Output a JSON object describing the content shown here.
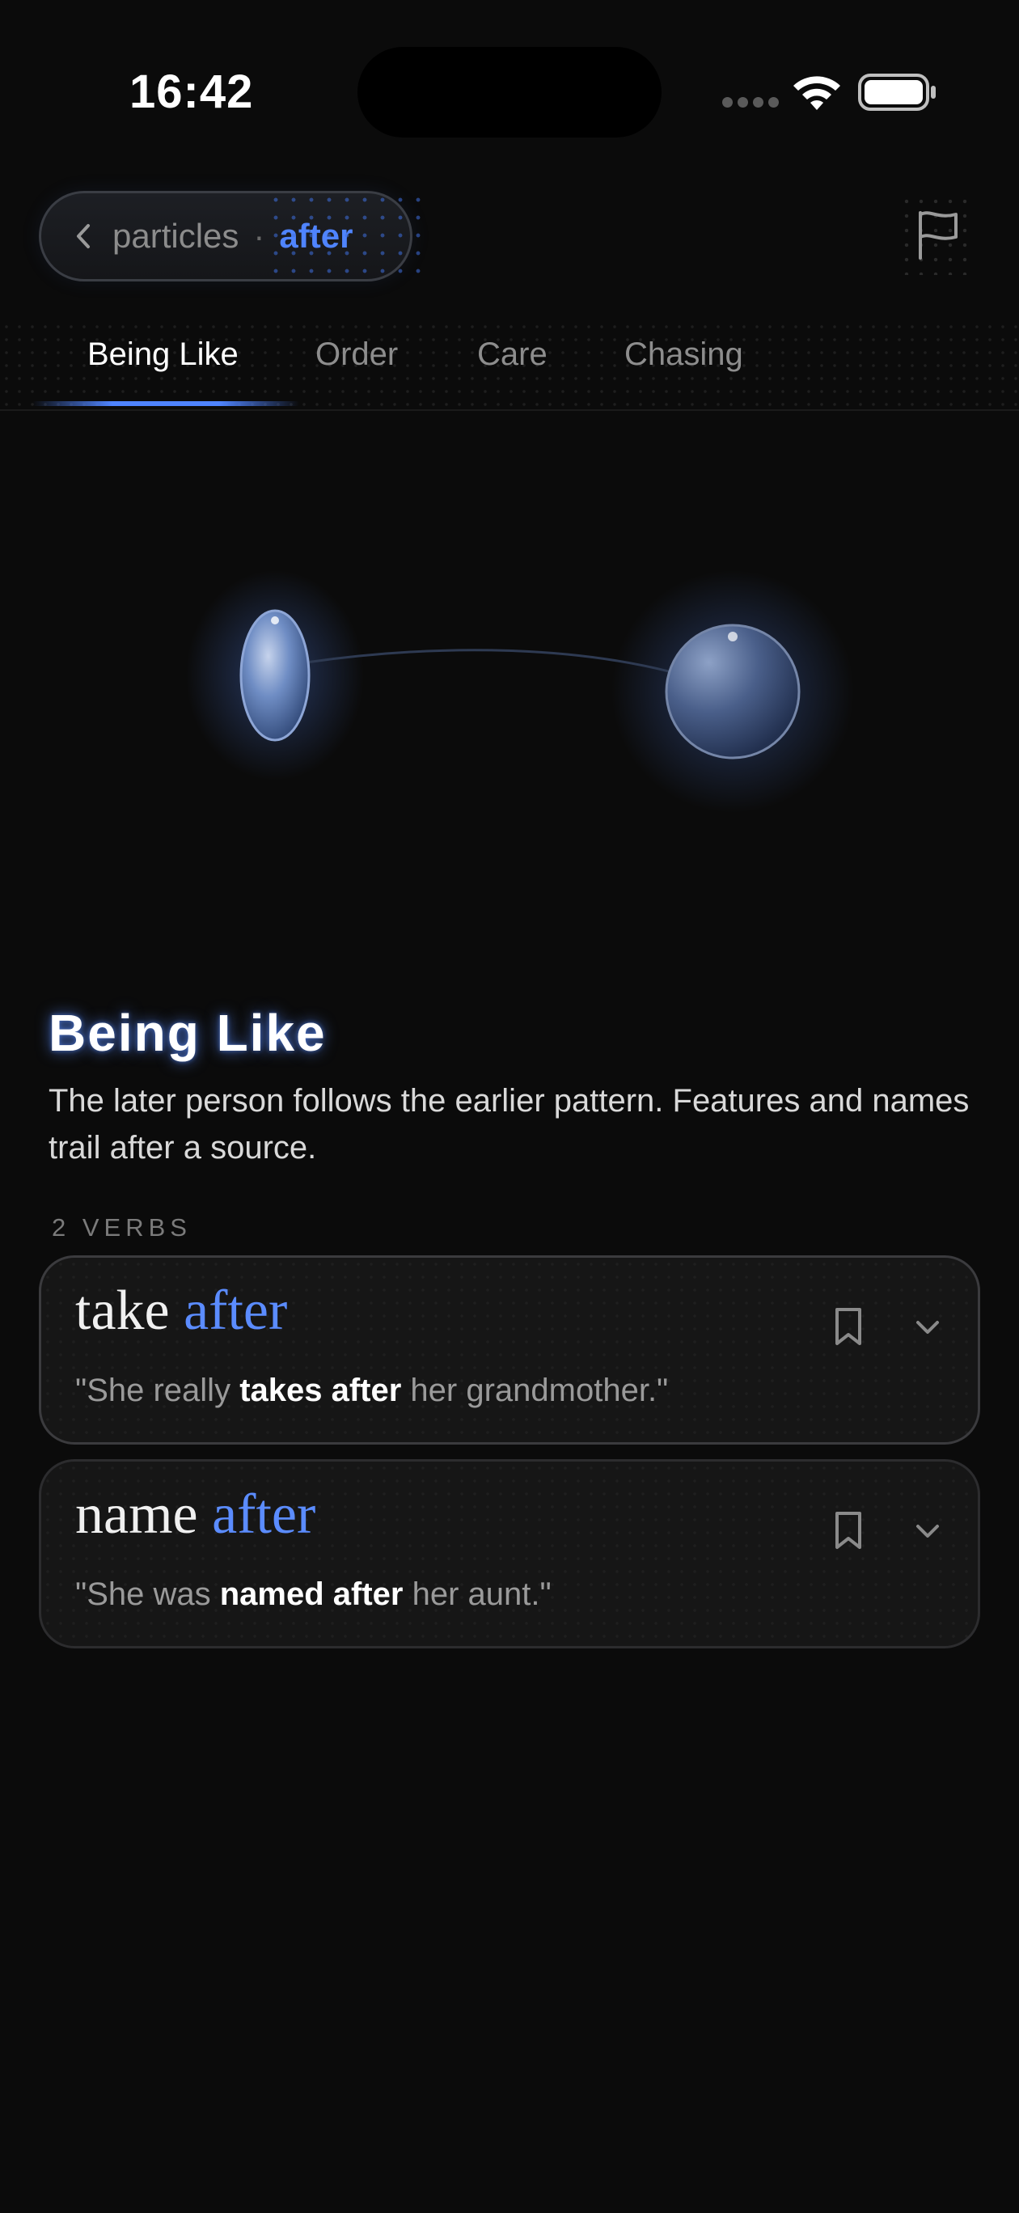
{
  "status_bar": {
    "time": "16:42",
    "icons": [
      "signal-dots-icon",
      "wifi-icon",
      "battery-icon"
    ]
  },
  "header": {
    "breadcrumb": {
      "parent": "particles",
      "separator": "·",
      "current": "after"
    },
    "icons": [
      "chevron-left-icon",
      "flag-icon"
    ]
  },
  "tabs": [
    {
      "label": "Being Like",
      "active": true
    },
    {
      "label": "Order",
      "active": false
    },
    {
      "label": "Care",
      "active": false
    },
    {
      "label": "Chasing",
      "active": false
    }
  ],
  "section": {
    "title": "Being Like",
    "description": "The later person follows the earlier pattern. Features and names trail after a source.",
    "verb_count": "2 VERBS"
  },
  "verbs": [
    {
      "verb": "take",
      "particle": "after",
      "example_before": "\"She really ",
      "example_bold": "takes after",
      "example_after": " her grandmother.\""
    },
    {
      "verb": "name",
      "particle": "after",
      "example_before": "\"She was ",
      "example_bold": "named after",
      "example_after": " her aunt.\""
    }
  ],
  "colors": {
    "background": "#0b0b0b",
    "accent": "#4f84ff",
    "card_border": "#2c2c2e",
    "muted_text": "#8d8d8d"
  },
  "card_icons": [
    "bookmark-icon",
    "chevron-down-icon"
  ]
}
